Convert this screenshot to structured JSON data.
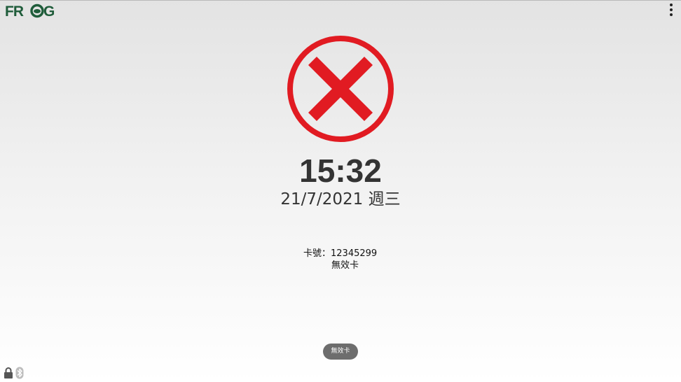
{
  "header": {
    "logo_text": "FROG",
    "menu_icon": "more-vert-icon"
  },
  "result": {
    "icon": "cross-in-circle-icon",
    "color": "#e11b22"
  },
  "clock": {
    "time": "15:32",
    "date": "21/7/2021 週三"
  },
  "card": {
    "number_label": "卡號：12345299",
    "status": "無效卡"
  },
  "toast": {
    "message": "無效卡"
  },
  "status_bar": {
    "icons": [
      "lock-icon",
      "bluetooth-icon"
    ]
  },
  "colors": {
    "brand_green": "#1f5c3a",
    "text": "#333333",
    "toast_bg": "#6d6d6d"
  }
}
